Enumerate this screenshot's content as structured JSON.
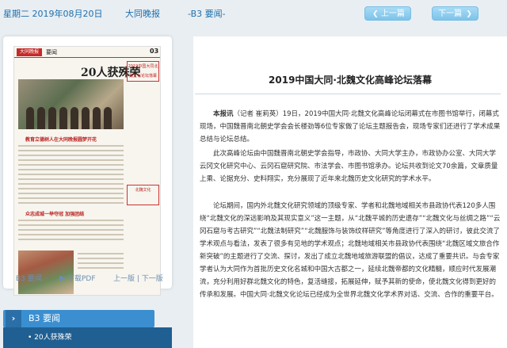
{
  "header": {
    "date": "星期二 2019年08月20日",
    "paper_name": "大同晚报",
    "page_label": "-B3 要闻-",
    "prev_button": "上一篇",
    "next_button": "下一篇"
  },
  "newspaper_page": {
    "logo": "大同晚报",
    "page_type": "要闻",
    "page_number": "03",
    "headline": "20人获殊荣",
    "red_heading_1": "教育立德树人在大同晚报圆梦开花",
    "red_heading_2": "众志成城一举夺冠 加强团结",
    "sidebar_tags": [
      "2019中国大同北魏文化论坛落幕",
      "北魏文化"
    ]
  },
  "left_footer": {
    "page": "B3 要闻",
    "download": "下载PDF",
    "nav": "上一版 | 下一版"
  },
  "section": {
    "header": "B3 要闻",
    "items": [
      "• 20人获殊荣"
    ]
  },
  "article": {
    "title": "2019中国大同·北魏文化高峰论坛落幕",
    "lead_label": "本报讯",
    "p1_rest": "（记者 崔莉英）19日，2019中国大同·北魏文化高峰论坛闭幕式在市图书馆举行，闭幕式现场，中国魏晋南北朝史学会会长楼劲等6位专家做了论坛主题报告会，现场专家们还进行了学术成果总结与论坛总结。",
    "p2": "此次高峰论坛由中国魏晋南北朝史学会指导，市政协、大同大学主办，市政协办公室、大同大学云冈文化研究中心、云冈石窟研究院、市法学会、市图书馆承办。论坛共收到论文70余篇，文章质量上乘、论据充分、史料翔实，充分展现了近年来北魏历史文化研究的学术水平。",
    "p3": "论坛期间，国内外北魏文化研究领域的顶级专家、学者和北魏地域相关市县政协代表120多人围绕“北魏文化的深远影响及其现实意义”这一主题，从“北魏平城的历史遗存”“北魏文化与丝绸之路”“云冈石窟与考古研究”“北魏法制研究”“北魏服饰与装饰纹样研究”等角度进行了深入的研讨，彼此交流了学术观点与看法，发表了很多有见地的学术观点；北魏地域相关市县政协代表围绕“北魏区域文旅合作新突破”的主题进行了交流、探讨，发出了成立北魏地域旅游联盟的倡议，达成了重要共识。与会专家学者认为大同作为首批历史文化名城和中国大古都之一，延续北魏帝都的文化精髓，顺应时代发展潮流，充分利用好群北魏文化的特色，复活缝接，拓展延伸，赋予其新的使命，使北魏文化得到更好的传承和发展。中国大同·北魏文化论坛已经成为全世界北魏文化学术界对话、交流、合作的重要平台。"
  }
}
